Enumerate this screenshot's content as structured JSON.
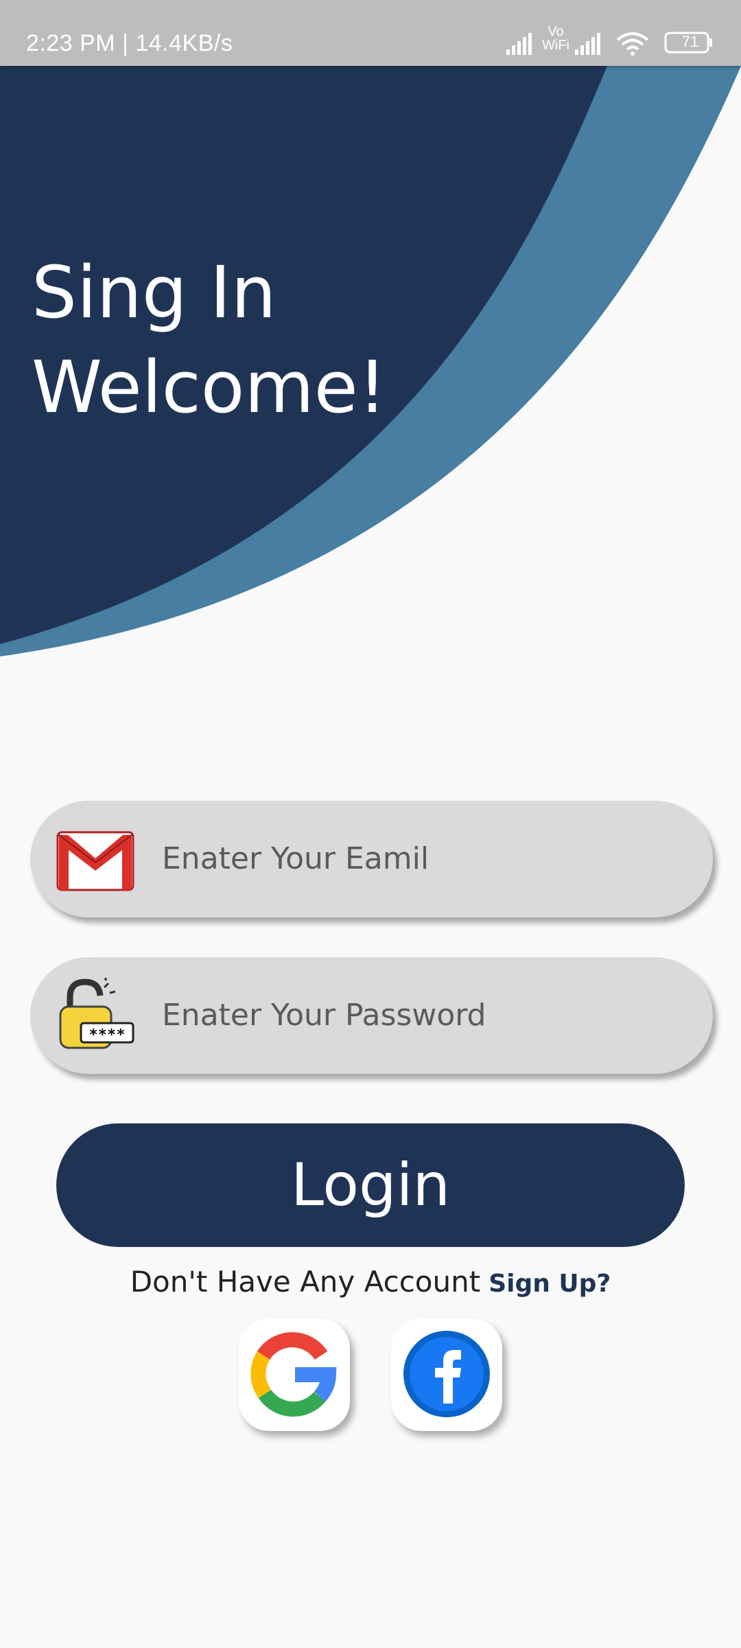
{
  "status_bar": {
    "time_speed": "2:23 PM | 14.4KB/s",
    "vowifi_label": "Vo WiFi",
    "battery": "71",
    "icons": [
      "signal-icon",
      "vowifi-icon",
      "signal-icon",
      "wifi-icon",
      "battery-icon"
    ]
  },
  "header": {
    "title": "Sing In",
    "subtitle": "Welcome!",
    "colors": {
      "dark": "#1f3455",
      "accent": "#477ea1"
    }
  },
  "form": {
    "email": {
      "placeholder": "Enater Your Eamil",
      "value": "",
      "icon": "gmail-icon"
    },
    "password": {
      "placeholder": "Enater Your Password",
      "value": "",
      "icon": "lock-password-icon"
    },
    "login_label": "Login"
  },
  "signup": {
    "prompt": "Don't Have Any Account",
    "link": "Sign Up?"
  },
  "social": [
    {
      "name": "google",
      "icon": "google-icon"
    },
    {
      "name": "facebook",
      "icon": "facebook-icon",
      "glyph": "f"
    }
  ]
}
